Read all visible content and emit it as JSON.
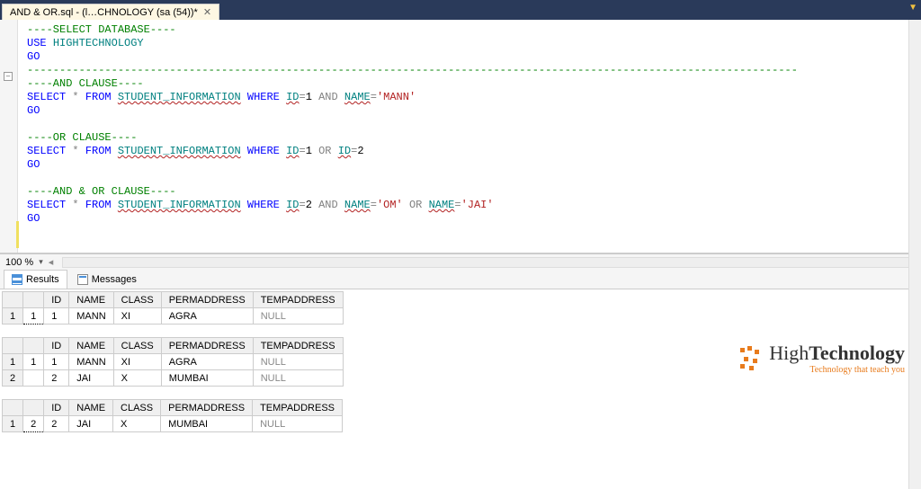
{
  "tab": {
    "title": "AND & OR.sql - (l…CHNOLOGY (sa (54))*"
  },
  "code": {
    "lines": [
      {
        "tokens": [
          {
            "t": "----SELECT DATABASE----",
            "c": "k-green"
          }
        ]
      },
      {
        "tokens": [
          {
            "t": "USE ",
            "c": "k-blue"
          },
          {
            "t": "HIGHTECHNOLOGY",
            "c": "k-teal"
          }
        ]
      },
      {
        "tokens": [
          {
            "t": "GO",
            "c": "k-blue"
          }
        ]
      },
      {
        "tokens": [
          {
            "t": "-----------------------------------------------------------------------------------------------------------------------",
            "c": "k-green"
          }
        ]
      },
      {
        "tokens": [
          {
            "t": "----AND CLAUSE----",
            "c": "k-green"
          }
        ]
      },
      {
        "tokens": [
          {
            "t": "SELECT ",
            "c": "k-blue"
          },
          {
            "t": "* ",
            "c": "k-gray"
          },
          {
            "t": "FROM ",
            "c": "k-blue"
          },
          {
            "t": "STUDENT_INFORMATION",
            "c": "k-teal underline"
          },
          {
            "t": " WHERE ",
            "c": "k-blue"
          },
          {
            "t": "ID",
            "c": "k-teal underline"
          },
          {
            "t": "=",
            "c": "k-gray"
          },
          {
            "t": "1",
            "c": "k-black"
          },
          {
            "t": " AND ",
            "c": "k-gray"
          },
          {
            "t": "NAME",
            "c": "k-teal underline"
          },
          {
            "t": "=",
            "c": "k-gray"
          },
          {
            "t": "'MANN'",
            "c": "k-red"
          }
        ]
      },
      {
        "tokens": [
          {
            "t": "GO",
            "c": "k-blue"
          }
        ]
      },
      {
        "tokens": []
      },
      {
        "tokens": [
          {
            "t": "----OR CLAUSE----",
            "c": "k-green"
          }
        ]
      },
      {
        "tokens": [
          {
            "t": "SELECT ",
            "c": "k-blue"
          },
          {
            "t": "* ",
            "c": "k-gray"
          },
          {
            "t": "FROM ",
            "c": "k-blue"
          },
          {
            "t": "STUDENT_INFORMATION",
            "c": "k-teal underline"
          },
          {
            "t": " WHERE ",
            "c": "k-blue"
          },
          {
            "t": "ID",
            "c": "k-teal underline"
          },
          {
            "t": "=",
            "c": "k-gray"
          },
          {
            "t": "1",
            "c": "k-black"
          },
          {
            "t": " OR ",
            "c": "k-gray"
          },
          {
            "t": "ID",
            "c": "k-teal underline"
          },
          {
            "t": "=",
            "c": "k-gray"
          },
          {
            "t": "2",
            "c": "k-black"
          }
        ]
      },
      {
        "tokens": [
          {
            "t": "GO",
            "c": "k-blue"
          }
        ]
      },
      {
        "tokens": []
      },
      {
        "tokens": [
          {
            "t": "----AND & OR CLAUSE----",
            "c": "k-green"
          }
        ]
      },
      {
        "tokens": [
          {
            "t": "SELECT ",
            "c": "k-blue"
          },
          {
            "t": "* ",
            "c": "k-gray"
          },
          {
            "t": "FROM ",
            "c": "k-blue"
          },
          {
            "t": "STUDENT_INFORMATION",
            "c": "k-teal underline"
          },
          {
            "t": " WHERE ",
            "c": "k-blue"
          },
          {
            "t": "ID",
            "c": "k-teal underline"
          },
          {
            "t": "=",
            "c": "k-gray"
          },
          {
            "t": "2",
            "c": "k-black"
          },
          {
            "t": " AND ",
            "c": "k-gray"
          },
          {
            "t": "NAME",
            "c": "k-teal underline"
          },
          {
            "t": "=",
            "c": "k-gray"
          },
          {
            "t": "'OM'",
            "c": "k-red"
          },
          {
            "t": " OR ",
            "c": "k-gray"
          },
          {
            "t": "NAME",
            "c": "k-teal underline"
          },
          {
            "t": "=",
            "c": "k-gray"
          },
          {
            "t": "'JAI'",
            "c": "k-red"
          }
        ]
      },
      {
        "tokens": [
          {
            "t": "GO",
            "c": "k-blue"
          }
        ]
      }
    ]
  },
  "zoom": "100 %",
  "paneTabs": {
    "results": "Results",
    "messages": "Messages"
  },
  "columns": [
    "ID",
    "NAME",
    "CLASS",
    "PERMADDRESS",
    "TEMPADDRESS"
  ],
  "grids": [
    {
      "rows": [
        {
          "n": "1",
          "sel": "1",
          "cells": [
            "1",
            "MANN",
            "XI",
            "AGRA",
            {
              "v": "NULL",
              "null": true
            }
          ]
        }
      ]
    },
    {
      "rows": [
        {
          "n": "1",
          "sel": "1",
          "cells": [
            "1",
            "MANN",
            "XI",
            "AGRA",
            {
              "v": "NULL",
              "null": true
            }
          ]
        },
        {
          "n": "2",
          "sel": "",
          "cells": [
            "2",
            "JAI",
            "X",
            "MUMBAI",
            {
              "v": "NULL",
              "null": true
            }
          ]
        }
      ]
    },
    {
      "rows": [
        {
          "n": "1",
          "sel": "2",
          "cells": [
            "2",
            "JAI",
            "X",
            "MUMBAI",
            {
              "v": "NULL",
              "null": true
            }
          ]
        }
      ]
    }
  ],
  "watermark": {
    "main1": "High",
    "main2": "Technology",
    "sub": "Technology that teach you"
  }
}
